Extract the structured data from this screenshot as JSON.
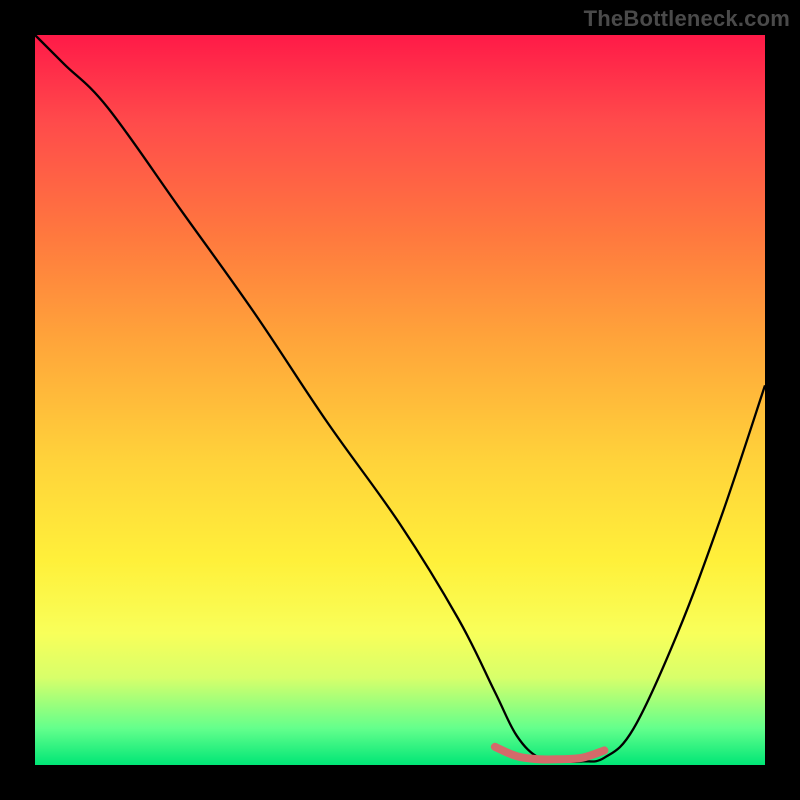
{
  "watermark": "TheBottleneck.com",
  "colors": {
    "background": "#000000",
    "gradient_top": "#ff1a48",
    "gradient_bottom": "#00e676",
    "curve": "#000000",
    "highlight": "#d46a6a"
  },
  "chart_data": {
    "type": "line",
    "title": "",
    "xlabel": "",
    "ylabel": "",
    "xlim": [
      0,
      100
    ],
    "ylim": [
      0,
      100
    ],
    "series": [
      {
        "name": "curve",
        "x": [
          0,
          4,
          10,
          20,
          30,
          40,
          50,
          58,
          63,
          66,
          69,
          72,
          75,
          78,
          82,
          88,
          94,
          100
        ],
        "y": [
          100,
          96,
          90,
          76,
          62,
          47,
          33,
          20,
          10,
          4,
          1,
          0.5,
          0.5,
          1,
          5,
          18,
          34,
          52
        ]
      },
      {
        "name": "highlight",
        "x": [
          63,
          66,
          69,
          72,
          75,
          78
        ],
        "y": [
          2.5,
          1.2,
          0.8,
          0.8,
          1.0,
          2.0
        ]
      }
    ]
  }
}
